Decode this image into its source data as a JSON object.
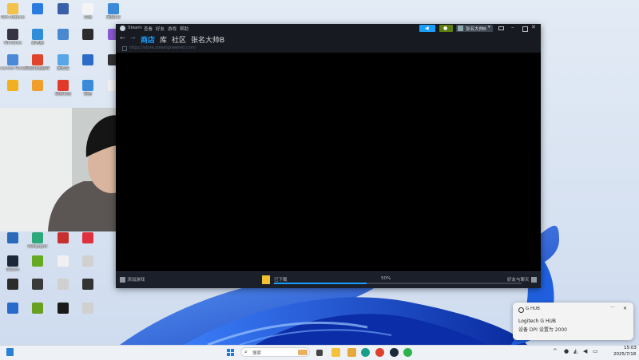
{
  "desktop_icons": [
    {
      "label": "Win·Addons",
      "color": "#f2c24a"
    },
    {
      "label": "Windows",
      "color": "#333344"
    },
    {
      "label": "Control Panel",
      "color": "#4b88d8"
    },
    {
      "label": "",
      "color": "#f0b020"
    },
    {
      "label": "",
      "color": "#2b7be0"
    },
    {
      "label": "此电脑",
      "color": "#2f8ed8"
    },
    {
      "label": "网易有道翻译",
      "color": "#e0452c"
    },
    {
      "label": "",
      "color": "#f0a02a"
    },
    {
      "label": "",
      "color": "#3a5fa8"
    },
    {
      "label": "",
      "color": "#4a88d0"
    },
    {
      "label": "回收站",
      "color": "#58a6e8"
    },
    {
      "label": "网易有道",
      "color": "#e03a2c"
    },
    {
      "label": "文档",
      "color": "#f4f4f4"
    },
    {
      "label": "",
      "color": "#2c2c2c"
    },
    {
      "label": "",
      "color": "#2c6cc8"
    },
    {
      "label": "网络",
      "color": "#3a8ad8"
    },
    {
      "label": "网易UU",
      "color": "#3a8ad8"
    },
    {
      "label": "",
      "color": "#8a5ad0"
    },
    {
      "label": "",
      "color": "#303030"
    },
    {
      "label": "",
      "color": "#f0f0f0"
    },
    {
      "label": "",
      "color": "#2a6ab8"
    },
    {
      "label": "Steam",
      "color": "#1b2838"
    },
    {
      "label": "",
      "color": "#2c2c2c"
    },
    {
      "label": "",
      "color": "#2a6ac8"
    },
    {
      "label": "Wallpaper",
      "color": "#2ca87a"
    },
    {
      "label": "",
      "color": "#66aa22"
    },
    {
      "label": "",
      "color": "#3a3a3a"
    },
    {
      "label": "",
      "color": "#68a020"
    },
    {
      "label": "",
      "color": "#c83030"
    },
    {
      "label": "",
      "color": "#f0f0f0"
    },
    {
      "label": "",
      "color": "#d0d0d0"
    },
    {
      "label": "",
      "color": "#1a1a1a"
    },
    {
      "label": "",
      "color": "#e03040"
    },
    {
      "label": "",
      "color": "#d0d0d0"
    },
    {
      "label": "",
      "color": "#333333"
    },
    {
      "label": "",
      "color": "#d0d0d0"
    },
    {
      "label": "",
      "color": "#d0d0d0"
    }
  ],
  "steam": {
    "title": "Steam",
    "menu": [
      "查看",
      "好友",
      "游戏",
      "帮助"
    ],
    "tabs": [
      "商店",
      "库",
      "社区",
      "张名大帅B"
    ],
    "url": "https://store.steampowered.com/",
    "account_name": "张名大帅B",
    "bottom_left": "添加游戏",
    "download_label": "已下载",
    "download_percent": "50%",
    "download_fraction": 0.5,
    "bottom_right": "好友与聊天"
  },
  "notification": {
    "app": "G HUB",
    "title": "Logitech G HUB",
    "body": "设备 DPI 设置为 2000"
  },
  "taskbar": {
    "search_placeholder": "搜索",
    "time": "15:03",
    "date": "2025/7/18"
  },
  "colors": {
    "steam_bg": "#171a21",
    "steam_accent": "#1a9fff",
    "steam_green": "#5c7e10",
    "wallpaper_blue": "#1d4fd0"
  }
}
